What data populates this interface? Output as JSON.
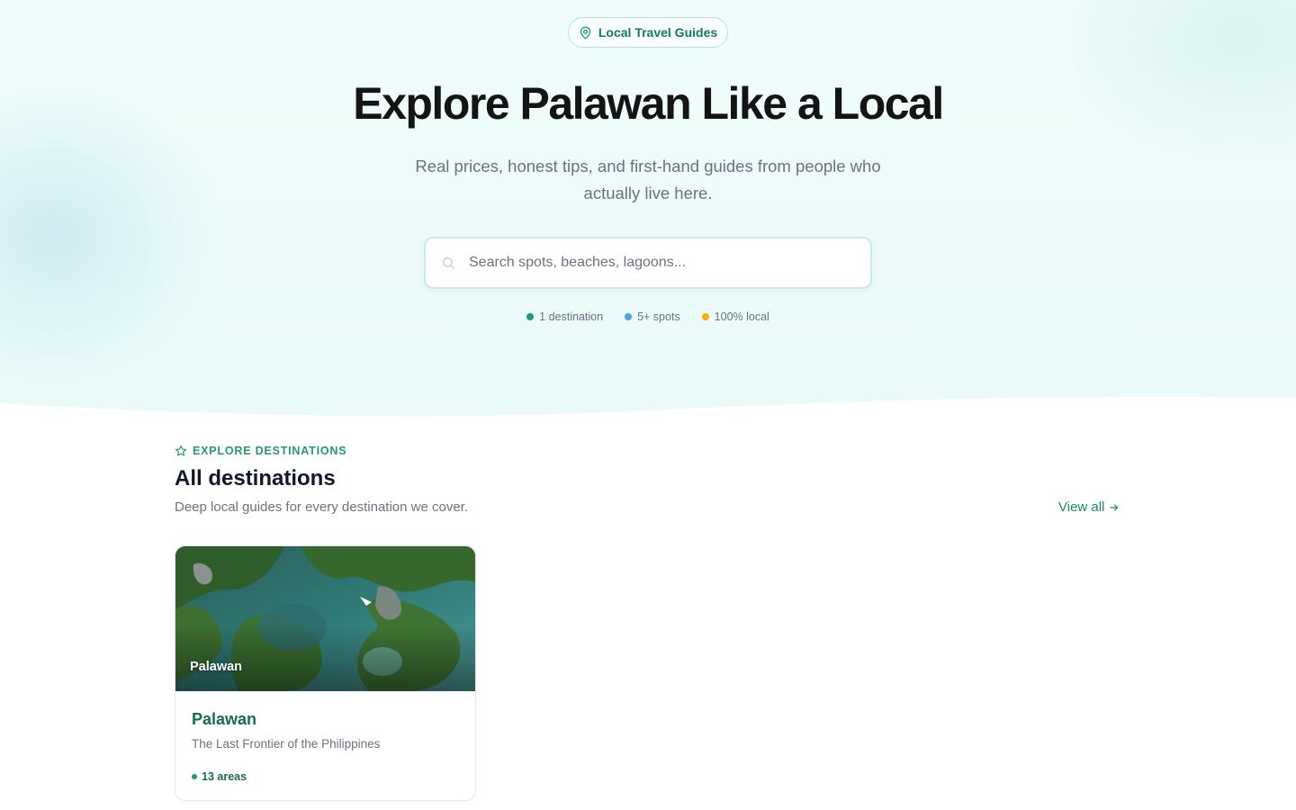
{
  "hero": {
    "badge_label": "Local Travel Guides",
    "badge_icon": "map-pin-icon",
    "title": "Explore Palawan Like a Local",
    "subtitle": "Real prices, honest tips, and first-hand guides from people who actually live here.",
    "search": {
      "placeholder": "Search spots, beaches, lagoons...",
      "value": "",
      "icon": "search-icon"
    },
    "stats": [
      {
        "label": "1 destination",
        "color": "#1f9a73"
      },
      {
        "label": "5+ spots",
        "color": "#4aa3e8"
      },
      {
        "label": "100% local",
        "color": "#f5b100"
      }
    ]
  },
  "section": {
    "eyebrow": "EXPLORE DESTINATIONS",
    "eyebrow_icon": "star-icon",
    "title": "All destinations",
    "subtitle": "Deep local guides for every destination we cover.",
    "view_all_label": "View all",
    "view_all_icon": "arrow-right-icon"
  },
  "destinations": [
    {
      "image_label": "Palawan",
      "name": "Palawan",
      "tagline": "The Last Frontier of the Philippines",
      "areas": "13 areas"
    }
  ],
  "colors": {
    "accent": "#1f9a73",
    "accent_dark": "#176b4e",
    "hero_bg": "#ecfbfa"
  }
}
